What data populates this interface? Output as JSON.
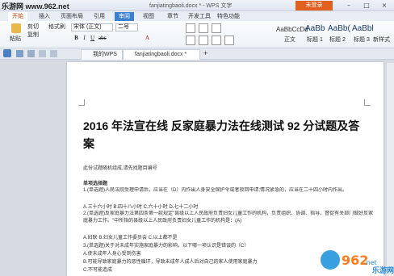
{
  "watermark": "乐游网 www.962.net",
  "window": {
    "title": "fanjiatingbaoli.docx * - WPS 文字",
    "login": "未登录"
  },
  "menu_tabs": [
    "开始",
    "插入",
    "页面布局",
    "引用",
    "审阅",
    "视图",
    "章节",
    "开发工具",
    "特色功能"
  ],
  "ribbon": {
    "paste": "粘贴",
    "cut": "剪切",
    "copy": "复制",
    "format_painter": "格式刷",
    "font_name": "宋体 (正文)",
    "font_size": "二号",
    "style_items": [
      {
        "preview": "AaBbCcDd",
        "label": "正文"
      },
      {
        "preview": "AaBb",
        "label": "标题 1"
      },
      {
        "preview": "AaBb(",
        "label": "标题 2"
      },
      {
        "preview": "AaBbl",
        "label": "标题 3"
      }
    ],
    "new_style": "新样式",
    "text_tools": "文字工具"
  },
  "doc_tabs": [
    {
      "label": "我的WPS"
    },
    {
      "label": "fanjiatingbaoli.docx *"
    }
  ],
  "document": {
    "heading": "2016 年法宣在线  反家庭暴力法在线测试 92 分试题及答案",
    "lines": [
      "此份试题随机组成,请先找题目编号",
      "单项选择题",
      "1.(单选题)人民法院受理申请后，应当在（D）内作出人身安全保护令或者驳回申请;情况紧急的，应当在二十四小时内作出。",
      "A.三十六小时 B.四十八小时 C.六十小时 D.七十二小时",
      "2.(单选题)反家庭暴力法第四条第一款规定\"县级以上人民政府负责妇女儿童工作的机构，负责组织、协调、指导、督促有关部门做好反家庭暴力工作。\"中所指的县级以上人民政府负责妇女儿童工作的机构是：(A)",
      "A.妇联  B.妇女儿童工作委员会  C.以上都不是",
      "3.(单选题)关于对未成年实施家庭暴力的影响，以下哪一项认识是错误的（C）",
      "A.使未成年人身心受到伤害",
      "B.可能导致家庭暴力的恶性循环，导致未成年人成人后对自己的家人使用家庭暴力",
      "C.不可能造成"
    ]
  },
  "logo": {
    "brand": "962",
    "dot": ".net",
    "site": "乐游网"
  }
}
